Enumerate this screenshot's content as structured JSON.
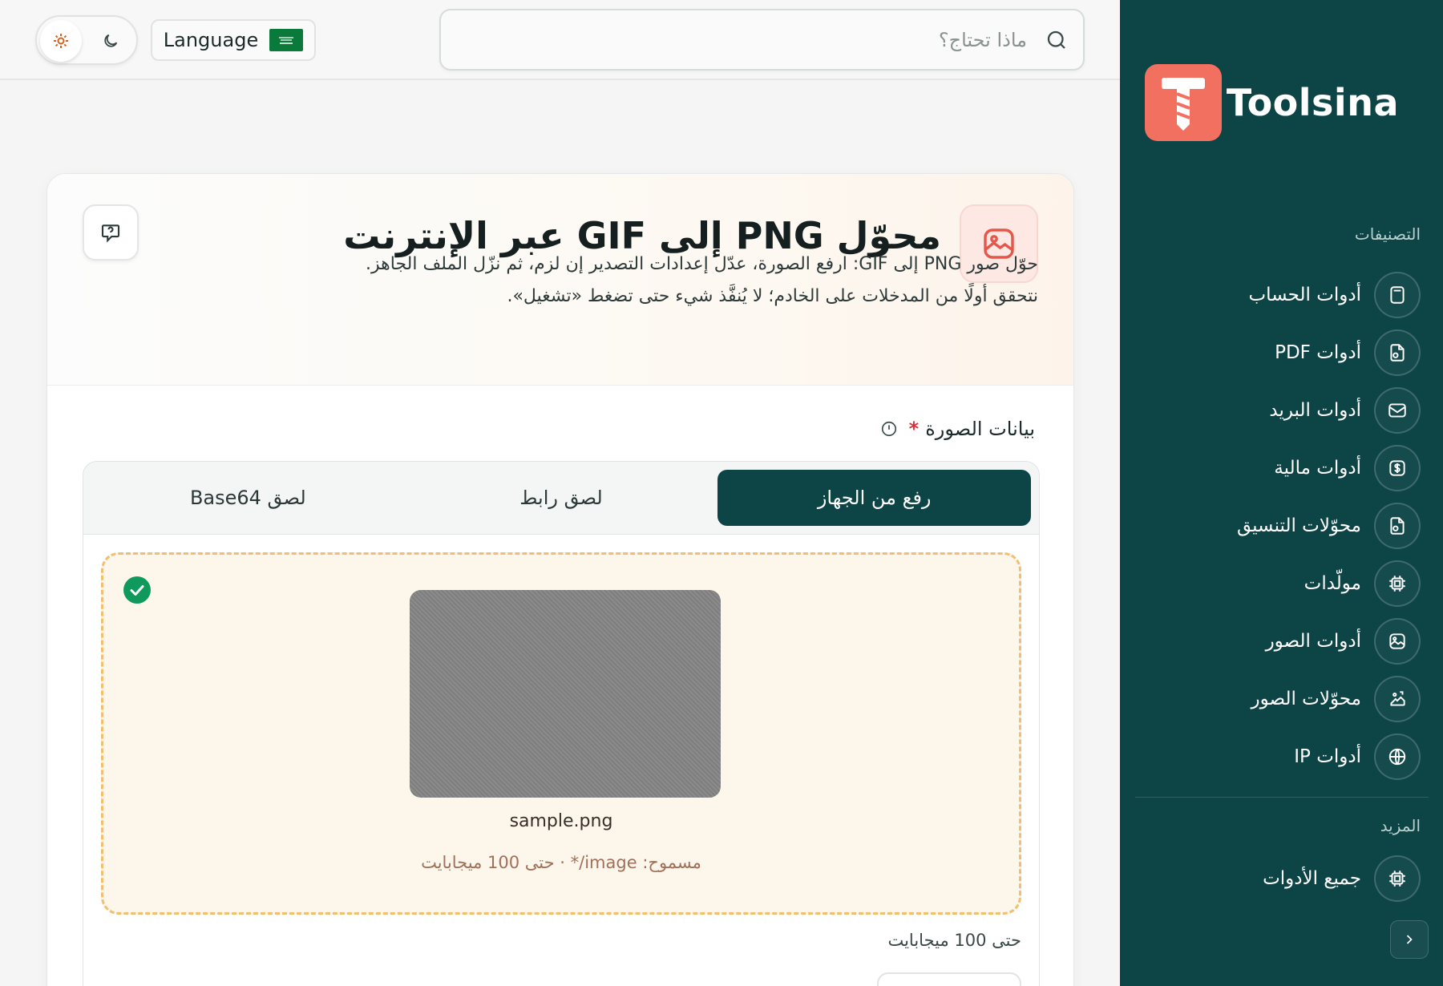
{
  "header": {
    "search_placeholder": "ماذا تحتاج؟",
    "language_label": "Language"
  },
  "sidebar": {
    "brand": "Toolsina",
    "categories_title": "التصنيفات",
    "items": [
      {
        "label": "أدوات الحساب",
        "icon": "calculator-icon"
      },
      {
        "label": "أدوات PDF",
        "icon": "file-icon"
      },
      {
        "label": "أدوات البريد",
        "icon": "mail-icon"
      },
      {
        "label": "أدوات مالية",
        "icon": "dollar-icon"
      },
      {
        "label": "محوّلات التنسيق",
        "icon": "file-convert-icon"
      },
      {
        "label": "مولّدات",
        "icon": "cpu-icon"
      },
      {
        "label": "أدوات الصور",
        "icon": "image-icon"
      },
      {
        "label": "محوّلات الصور",
        "icon": "image-convert-icon"
      },
      {
        "label": "أدوات IP",
        "icon": "globe-icon"
      }
    ],
    "more_title": "المزيد",
    "more_items": [
      {
        "label": "جميع الأدوات",
        "icon": "cpu-icon"
      }
    ]
  },
  "main": {
    "title": "محوّل PNG إلى GIF عبر الإنترنت",
    "description_line1": "حوّل صور PNG إلى GIF: ارفع الصورة، عدّل إعدادات التصدير إن لزم، ثم نزّل الملف الجاهز.",
    "description_line2": "نتحقق أولًا من المدخلات على الخادم؛ لا يُنفَّذ شيء حتى تضغط «تشغيل».",
    "field_label": "بيانات الصورة",
    "required_mark": "*",
    "tabs": [
      {
        "label": "رفع من الجهاز",
        "active": true
      },
      {
        "label": "لصق رابط",
        "active": false
      },
      {
        "label": "لصق Base64",
        "active": false
      }
    ],
    "upload": {
      "filename": "sample.png",
      "allowed_text": "مسموح: image/* · حتى 100 ميجابايت"
    },
    "size_note": "حتى 100 ميجابايت"
  },
  "colors": {
    "sidebar_bg": "#0d4446",
    "brand_accent": "#f2705f",
    "active_tab": "#0d4446",
    "dropzone_border": "#f2be6f",
    "success": "#0f9a5c"
  }
}
